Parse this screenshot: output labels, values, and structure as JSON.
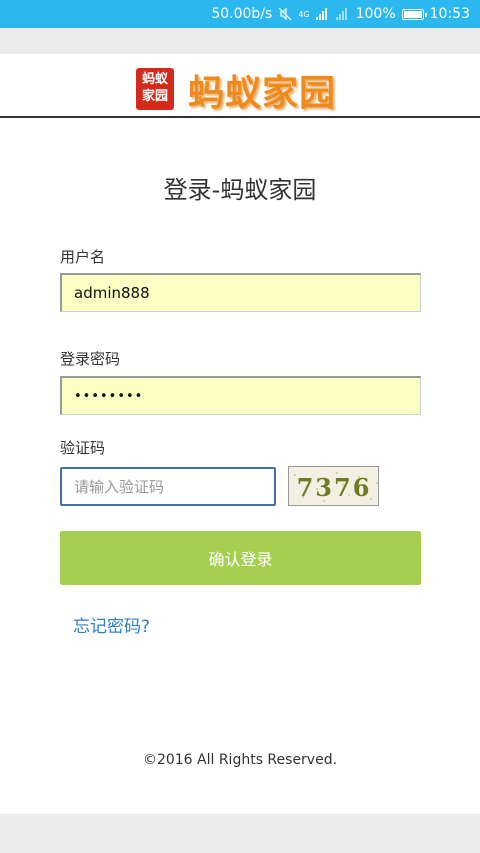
{
  "status_bar": {
    "net_speed": "50.00b/s",
    "net_type": "4G",
    "battery": "100%",
    "time": "10:53",
    "icons": [
      "mute-icon",
      "signal-icon",
      "signal-icon-2",
      "battery-icon"
    ]
  },
  "header": {
    "logo_badge_line1": "蚂蚁",
    "logo_badge_line2": "家园",
    "logo_text": "蚂蚁家园"
  },
  "page_title": "登录-蚂蚁家园",
  "form": {
    "username_label": "用户名",
    "username_value": "admin888",
    "password_label": "登录密码",
    "password_value": "••••••••",
    "captcha_label": "验证码",
    "captcha_placeholder": "请输入验证码",
    "captcha_image_text": "7376",
    "submit_label": "确认登录",
    "forgot_label": "忘记密码?"
  },
  "footer": {
    "copyright": "©2016 All Rights Reserved."
  },
  "colors": {
    "status_bar": "#2bb8ef",
    "input_fill": "#fbffc4",
    "button": "#a4cf50",
    "link": "#2f7ec4",
    "logo_text": "#f08a1c"
  }
}
